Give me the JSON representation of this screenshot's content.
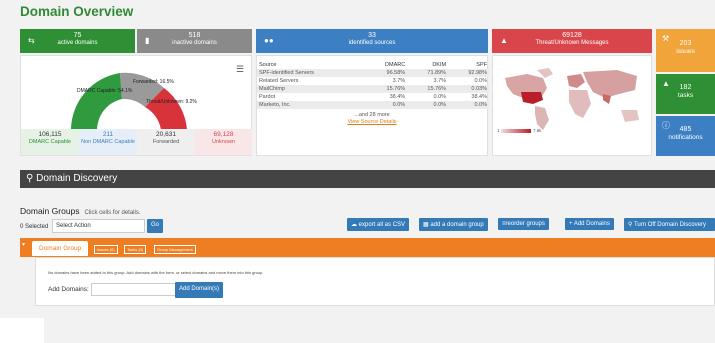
{
  "page": {
    "title": "Domain Overview"
  },
  "colors": {
    "green": "#2f8f35",
    "gray": "#8a8a8a",
    "blue": "#3d7fc3",
    "red": "#d8464b",
    "orange": "#f0a43a",
    "orange_bar": "#ef7d22",
    "dark": "#444444"
  },
  "tiles": [
    {
      "value": "75",
      "label": "active domains",
      "icon": "swap-icon"
    },
    {
      "value": "518",
      "label": "inactive domains",
      "icon": "document-icon"
    },
    {
      "value": "33",
      "label": "identified sources",
      "icon": "users-icon"
    },
    {
      "value": "69128",
      "label": "Threat/Unknown Messages",
      "icon": "warning-icon"
    }
  ],
  "gauge": {
    "forwarded_label": "Forwarded: 16.5%",
    "dmarc_label": "DMARC Capable: 54.1%",
    "threat_label": "Threat/Unknown: 9.2%",
    "menu_icon": "hamburger-icon"
  },
  "stats": [
    {
      "value": "106,115",
      "label": "DMARC Capable"
    },
    {
      "value": "211",
      "label": "Non DMARC Capable"
    },
    {
      "value": "20,631",
      "label": "Forwarded"
    },
    {
      "value": "69,128",
      "label": "Unknown"
    }
  ],
  "sources": {
    "headers": [
      "Source",
      "DMARC",
      "DKIM",
      "SPF"
    ],
    "rows": [
      [
        "SPF-identified Servers",
        "96.58%",
        "71.89%",
        "92.98%"
      ],
      [
        "Related Servers",
        "3.7%",
        "3.7%",
        "0.0%"
      ],
      [
        "MailChimp",
        "15.76%",
        "15.76%",
        "0.03%"
      ],
      [
        "Pardot",
        "38.4%",
        "0.0%",
        "38.4%"
      ],
      [
        "Marketo, Inc.",
        "0.0%",
        "0.0%",
        "0.0%"
      ]
    ],
    "more": "...and 28 more",
    "details_link": "View Source Details"
  },
  "map": {
    "legend_min": "1",
    "legend_max": "7.6k"
  },
  "side": [
    {
      "value": "203",
      "label": "issues",
      "icon": "wrench-icon"
    },
    {
      "value": "182",
      "label": "tasks",
      "icon": "pin-icon"
    },
    {
      "value": "485",
      "label": "notifications",
      "icon": "info-icon"
    }
  ],
  "discovery": {
    "title": "Domain Discovery",
    "icon": "search-icon"
  },
  "groups": {
    "title": "Domain Groups",
    "hint": "Click cells for details.",
    "selected": "0 Selected",
    "select_action": "Select Action",
    "go": "Go"
  },
  "buttons": {
    "export": "export all as CSV",
    "add_group": "add a domain group",
    "reorder": "reorder groups",
    "add_domains": "+ Add Domains",
    "turn_off": "Turn Off Domain Discovery"
  },
  "tabs": [
    {
      "label": "Domain Group"
    },
    {
      "label": "Issues (0)"
    },
    {
      "label": "Tasks (0)"
    },
    {
      "label": "Group Management"
    }
  ],
  "card": {
    "message": "No domains have been added to this group. Add domains with the form, or select domains and move them into this group.",
    "add_label": "Add Domains:",
    "input_value": "",
    "add_button": "Add Domain(s)"
  }
}
